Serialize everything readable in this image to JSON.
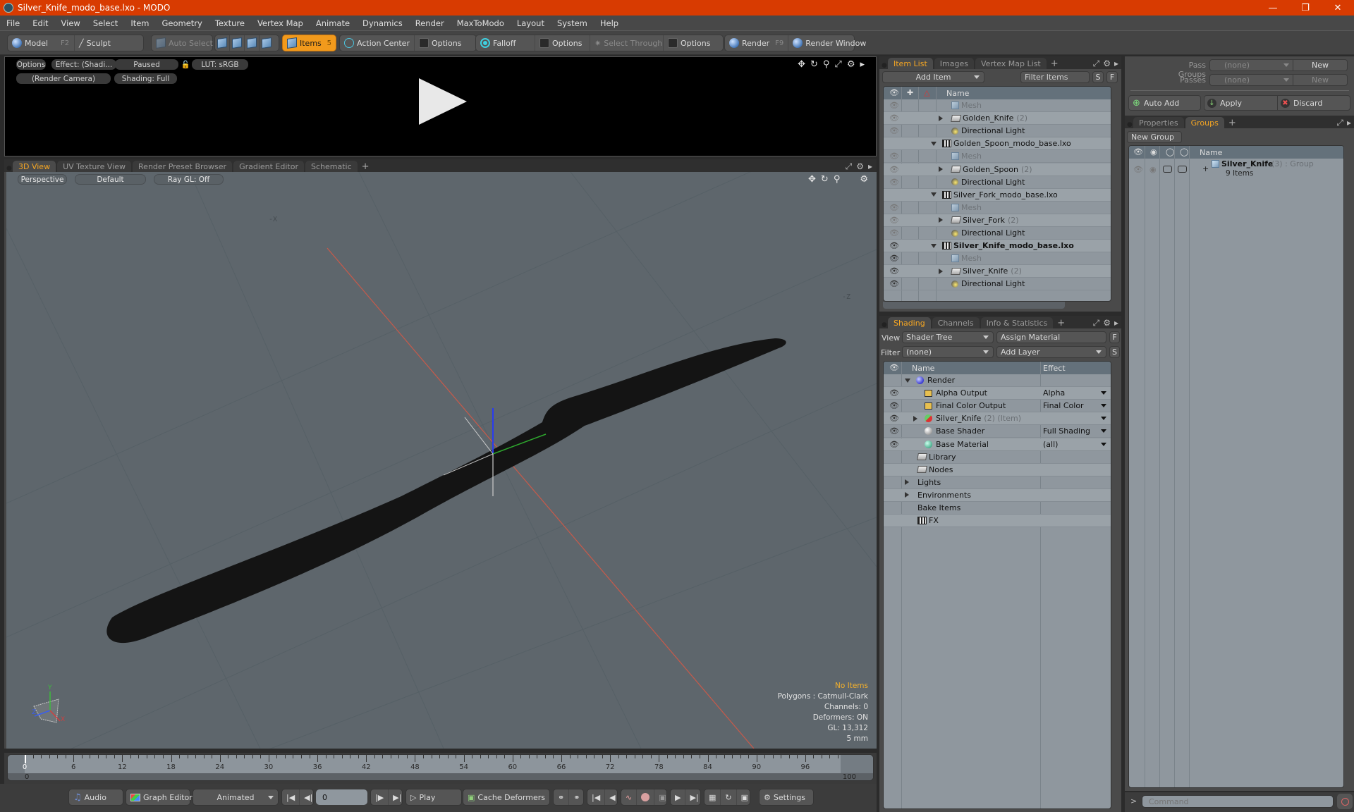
{
  "window": {
    "title": "Silver_Knife_modo_base.lxo - MODO",
    "controls": [
      "minimize",
      "restore",
      "close"
    ]
  },
  "menu": [
    "File",
    "Edit",
    "View",
    "Select",
    "Item",
    "Geometry",
    "Texture",
    "Vertex Map",
    "Animate",
    "Dynamics",
    "Render",
    "MaxToModo",
    "Layout",
    "System",
    "Help"
  ],
  "toolbar": {
    "model": "Model",
    "model_key": "F2",
    "sculpt": "Sculpt",
    "auto_select": "Auto Select",
    "items": "Items",
    "items_count": "5",
    "action_center": "Action Center",
    "options1": "Options",
    "falloff": "Falloff",
    "options2": "Options",
    "select_through": "Select Through",
    "options3": "Options",
    "render": "Render",
    "render_key": "F9",
    "render_window": "Render Window"
  },
  "render_preview": {
    "options": "Options",
    "effect": "Effect: (Shadi...",
    "status": "Paused",
    "lut": "LUT: sRGB",
    "camera": "(Render Camera)",
    "shading": "Shading: Full"
  },
  "viewport_tabs": [
    {
      "label": "3D View",
      "active": true
    },
    {
      "label": "UV Texture View",
      "active": false
    },
    {
      "label": "Render Preset Browser",
      "active": false
    },
    {
      "label": "Gradient Editor",
      "active": false
    },
    {
      "label": "Schematic",
      "active": false
    }
  ],
  "viewport": {
    "view_mode": "Perspective",
    "shading": "Default",
    "raygl": "Ray GL: Off",
    "axis_labels": {
      "neg_x": "-X",
      "neg_z": "-Z",
      "x": "X",
      "y": "Y",
      "z": "Z"
    },
    "stats": {
      "selection": "No Items",
      "polygons": "Polygons : Catmull-Clark",
      "channels": "Channels: 0",
      "deformers": "Deformers: ON",
      "gl": "GL: 13,312",
      "grid": "5 mm"
    }
  },
  "timeline": {
    "ticks": [
      "0",
      "6",
      "12",
      "18",
      "24",
      "30",
      "36",
      "42",
      "48",
      "54",
      "60",
      "66",
      "72",
      "78",
      "84",
      "90",
      "96"
    ],
    "range_start": "0",
    "range_end": "100",
    "current_frame": 0
  },
  "bottombar": {
    "audio": "Audio",
    "graph_editor": "Graph Editor",
    "animated": "Animated",
    "frame_value": "0",
    "play": "Play",
    "cache_deformers": "Cache Deformers",
    "settings": "Settings"
  },
  "item_list": {
    "tabs": [
      {
        "label": "Item List",
        "active": true
      },
      {
        "label": "Images",
        "active": false
      },
      {
        "label": "Vertex Map List",
        "active": false
      }
    ],
    "add_item": "Add Item",
    "filter_placeholder": "Filter Items",
    "s_btn": "S",
    "f_btn": "F",
    "column_name": "Name",
    "rows": [
      {
        "name": "Mesh",
        "count": "",
        "type": "mesh",
        "indent": 2,
        "eye": "dim",
        "muted": true
      },
      {
        "name": "Golden_Knife",
        "count": "(2)",
        "type": "group",
        "indent": 2,
        "eye": "dim",
        "expand": "right"
      },
      {
        "name": "Directional Light",
        "count": "",
        "type": "light",
        "indent": 2,
        "eye": "dim"
      },
      {
        "name": "Golden_Spoon_modo_base.lxo",
        "count": "",
        "type": "scene",
        "indent": 1,
        "eye": "none",
        "expand": "down"
      },
      {
        "name": "Mesh",
        "count": "",
        "type": "mesh",
        "indent": 2,
        "eye": "dim",
        "muted": true
      },
      {
        "name": "Golden_Spoon",
        "count": "(2)",
        "type": "group",
        "indent": 2,
        "eye": "dim",
        "expand": "right"
      },
      {
        "name": "Directional Light",
        "count": "",
        "type": "light",
        "indent": 2,
        "eye": "dim"
      },
      {
        "name": "Silver_Fork_modo_base.lxo",
        "count": "",
        "type": "scene",
        "indent": 1,
        "eye": "none",
        "expand": "down"
      },
      {
        "name": "Mesh",
        "count": "",
        "type": "mesh",
        "indent": 2,
        "eye": "dim",
        "muted": true
      },
      {
        "name": "Silver_Fork",
        "count": "(2)",
        "type": "group",
        "indent": 2,
        "eye": "dim",
        "expand": "right"
      },
      {
        "name": "Directional Light",
        "count": "",
        "type": "light",
        "indent": 2,
        "eye": "dim"
      },
      {
        "name": "Silver_Knife_modo_base.lxo",
        "count": "",
        "type": "scene",
        "indent": 1,
        "eye": "on",
        "expand": "down",
        "bold": true
      },
      {
        "name": "Mesh",
        "count": "",
        "type": "mesh",
        "indent": 2,
        "eye": "on",
        "muted": true
      },
      {
        "name": "Silver_Knife",
        "count": "(2)",
        "type": "group",
        "indent": 2,
        "eye": "on",
        "expand": "right"
      },
      {
        "name": "Directional Light",
        "count": "",
        "type": "light",
        "indent": 2,
        "eye": "on"
      }
    ]
  },
  "shading": {
    "tabs": [
      {
        "label": "Shading",
        "active": true
      },
      {
        "label": "Channels",
        "active": false
      },
      {
        "label": "Info & Statistics",
        "active": false
      }
    ],
    "view_label": "View",
    "view_value": "Shader Tree",
    "assign_material": "Assign Material",
    "f_btn": "F",
    "filter_label": "Filter",
    "filter_value": "(none)",
    "add_layer": "Add Layer",
    "s_btn": "S",
    "col_name": "Name",
    "col_effect": "Effect",
    "rows": [
      {
        "name": "Render",
        "extra": "",
        "effect": "",
        "icon": "render-sphere",
        "indent": 0,
        "eye": false,
        "expand": "down",
        "dd": false
      },
      {
        "name": "Alpha Output",
        "extra": "",
        "effect": "Alpha",
        "icon": "output",
        "indent": 1,
        "eye": true,
        "dd": true
      },
      {
        "name": "Final Color Output",
        "extra": "",
        "effect": "Final Color",
        "icon": "output",
        "indent": 1,
        "eye": true,
        "dd": true
      },
      {
        "name": "Silver_Knife",
        "extra": "(2) (Item)",
        "effect": "",
        "icon": "material-group",
        "indent": 1,
        "eye": true,
        "expand": "right",
        "dd": true
      },
      {
        "name": "Base Shader",
        "extra": "",
        "effect": "Full Shading",
        "icon": "shader",
        "indent": 1,
        "eye": true,
        "dd": true
      },
      {
        "name": "Base Material",
        "extra": "",
        "effect": "(all)",
        "icon": "material",
        "indent": 1,
        "eye": true,
        "dd": true
      },
      {
        "name": "Library",
        "extra": "",
        "effect": "",
        "icon": "folder",
        "indent": -1,
        "eye": false,
        "dd": false
      },
      {
        "name": "Nodes",
        "extra": "",
        "effect": "",
        "icon": "folder",
        "indent": -1,
        "eye": false,
        "dd": false
      },
      {
        "name": "Lights",
        "extra": "",
        "effect": "",
        "icon": "none",
        "indent": -2,
        "eye": false,
        "expand": "right",
        "dd": false
      },
      {
        "name": "Environments",
        "extra": "",
        "effect": "",
        "icon": "none",
        "indent": -2,
        "eye": false,
        "expand": "right",
        "dd": false
      },
      {
        "name": "Bake Items",
        "extra": "",
        "effect": "",
        "icon": "none",
        "indent": -2,
        "eye": false,
        "dd": false
      },
      {
        "name": "FX",
        "extra": "",
        "effect": "",
        "icon": "scene",
        "indent": -1,
        "eye": false,
        "dd": false
      }
    ]
  },
  "passes": {
    "pass_groups_label": "Pass Groups",
    "pass_groups_value": "(none)",
    "passes_label": "Passes",
    "passes_value": "(none)",
    "new_btn": "New",
    "new_btn2": "New",
    "auto_add": "Auto Add",
    "apply": "Apply",
    "discard": "Discard"
  },
  "groups": {
    "tabs": [
      {
        "label": "Properties",
        "active": false
      },
      {
        "label": "Groups",
        "active": true
      }
    ],
    "new_group": "New Group",
    "col_name": "Name",
    "rows": [
      {
        "name": "Silver_Knife",
        "count": "(3)",
        "type": ": Group",
        "subtitle": "9 Items"
      }
    ]
  },
  "command": {
    "prompt": ">",
    "placeholder": "Command"
  },
  "colors": {
    "accent": "#f29a1c",
    "titlebar": "#d83b01",
    "tab_active_text": "#f5a623",
    "viewport_bg": "#5e666c",
    "knife": "#141414"
  }
}
